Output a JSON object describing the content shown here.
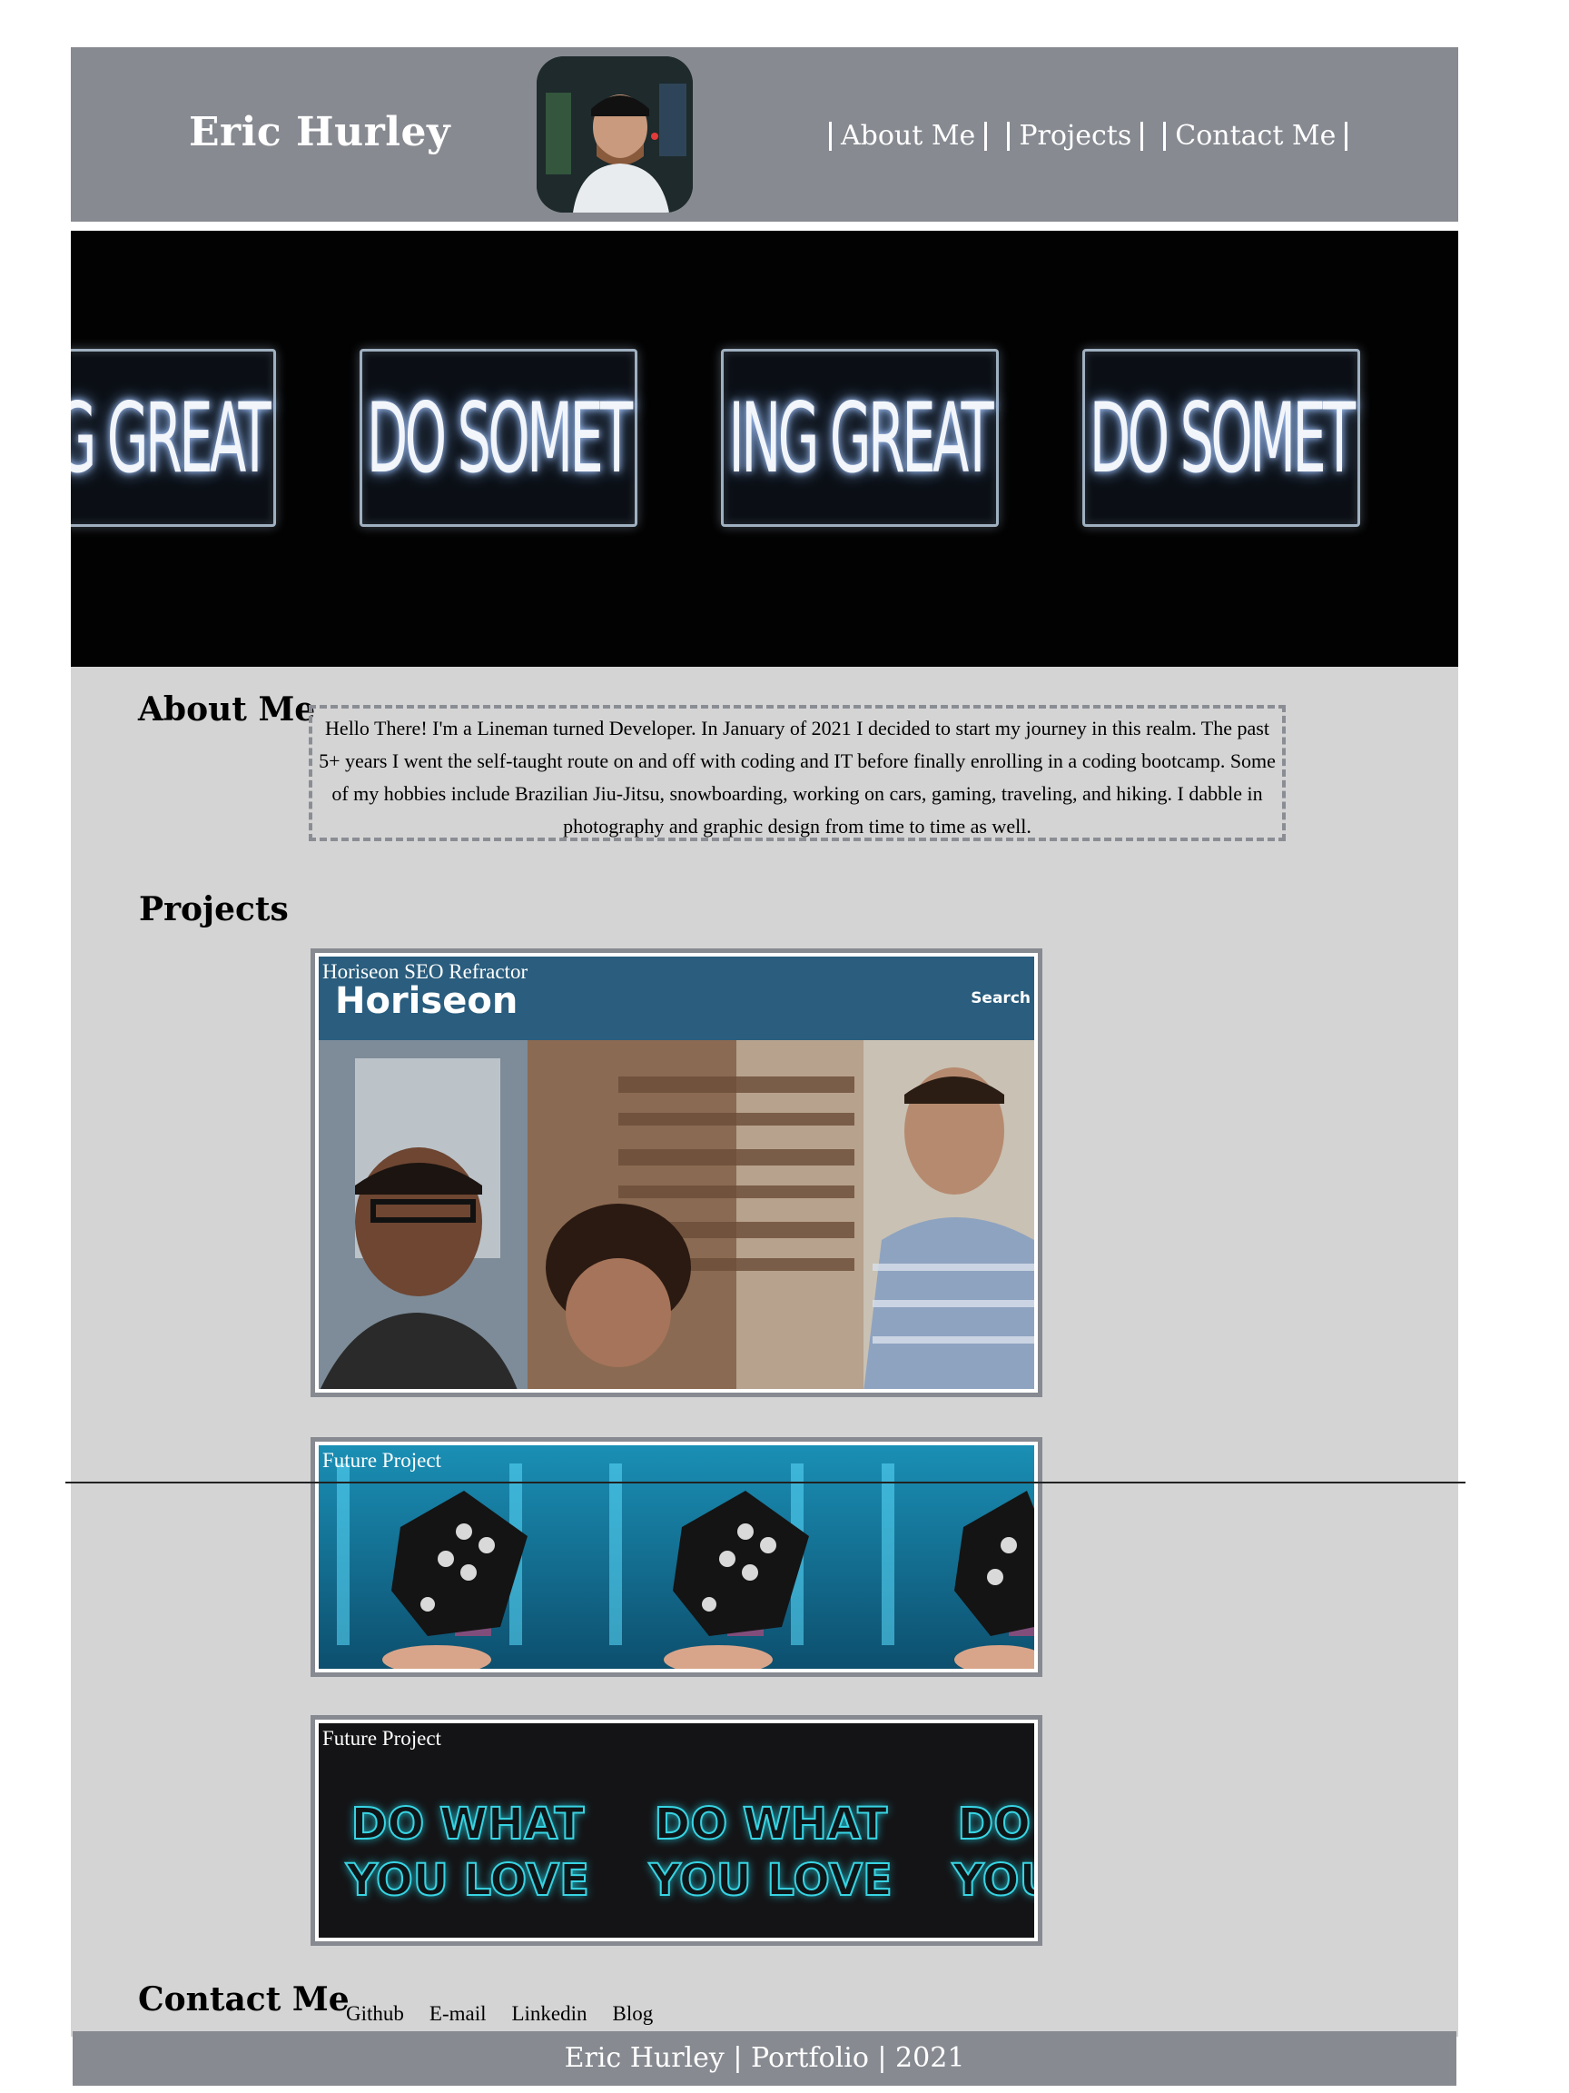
{
  "header": {
    "brand": "Eric Hurley",
    "nav": [
      "About Me",
      "Projects",
      "Contact Me"
    ]
  },
  "hero": {
    "sign_text": [
      "ING GREAT",
      "DO SOMET",
      "ING GREAT",
      "DO SOMET"
    ]
  },
  "about": {
    "title": "About Me",
    "text": "Hello There! I'm a Lineman turned Developer. In January of 2021 I decided to start my journey in this realm. The past 5+ years I went the self-taught route on and off with coding and IT before finally enrolling in a coding bootcamp. Some of my hobbies include Brazilian Jiu-Jitsu, snowboarding, working on cars, gaming, traveling, and hiking. I dabble in photography and graphic design from time to time as well."
  },
  "projects": {
    "title": "Projects",
    "items": [
      {
        "label": "Horiseon SEO Refractor",
        "logo": "Horiseon",
        "search": "Search"
      },
      {
        "label": "Future Project"
      },
      {
        "label": "Future Project",
        "sign_line1": "DO WHAT",
        "sign_line2": "YOU LOVE"
      }
    ]
  },
  "contact": {
    "title": "Contact Me",
    "links": [
      "Github",
      "E-mail",
      "Linkedin",
      "Blog"
    ]
  },
  "footer": {
    "text": "Eric Hurley | Portfolio | 2021"
  },
  "colors": {
    "header_bg": "#878a91",
    "main_bg": "#d4d4d4",
    "horiseon_bar": "#2a5d7e"
  }
}
